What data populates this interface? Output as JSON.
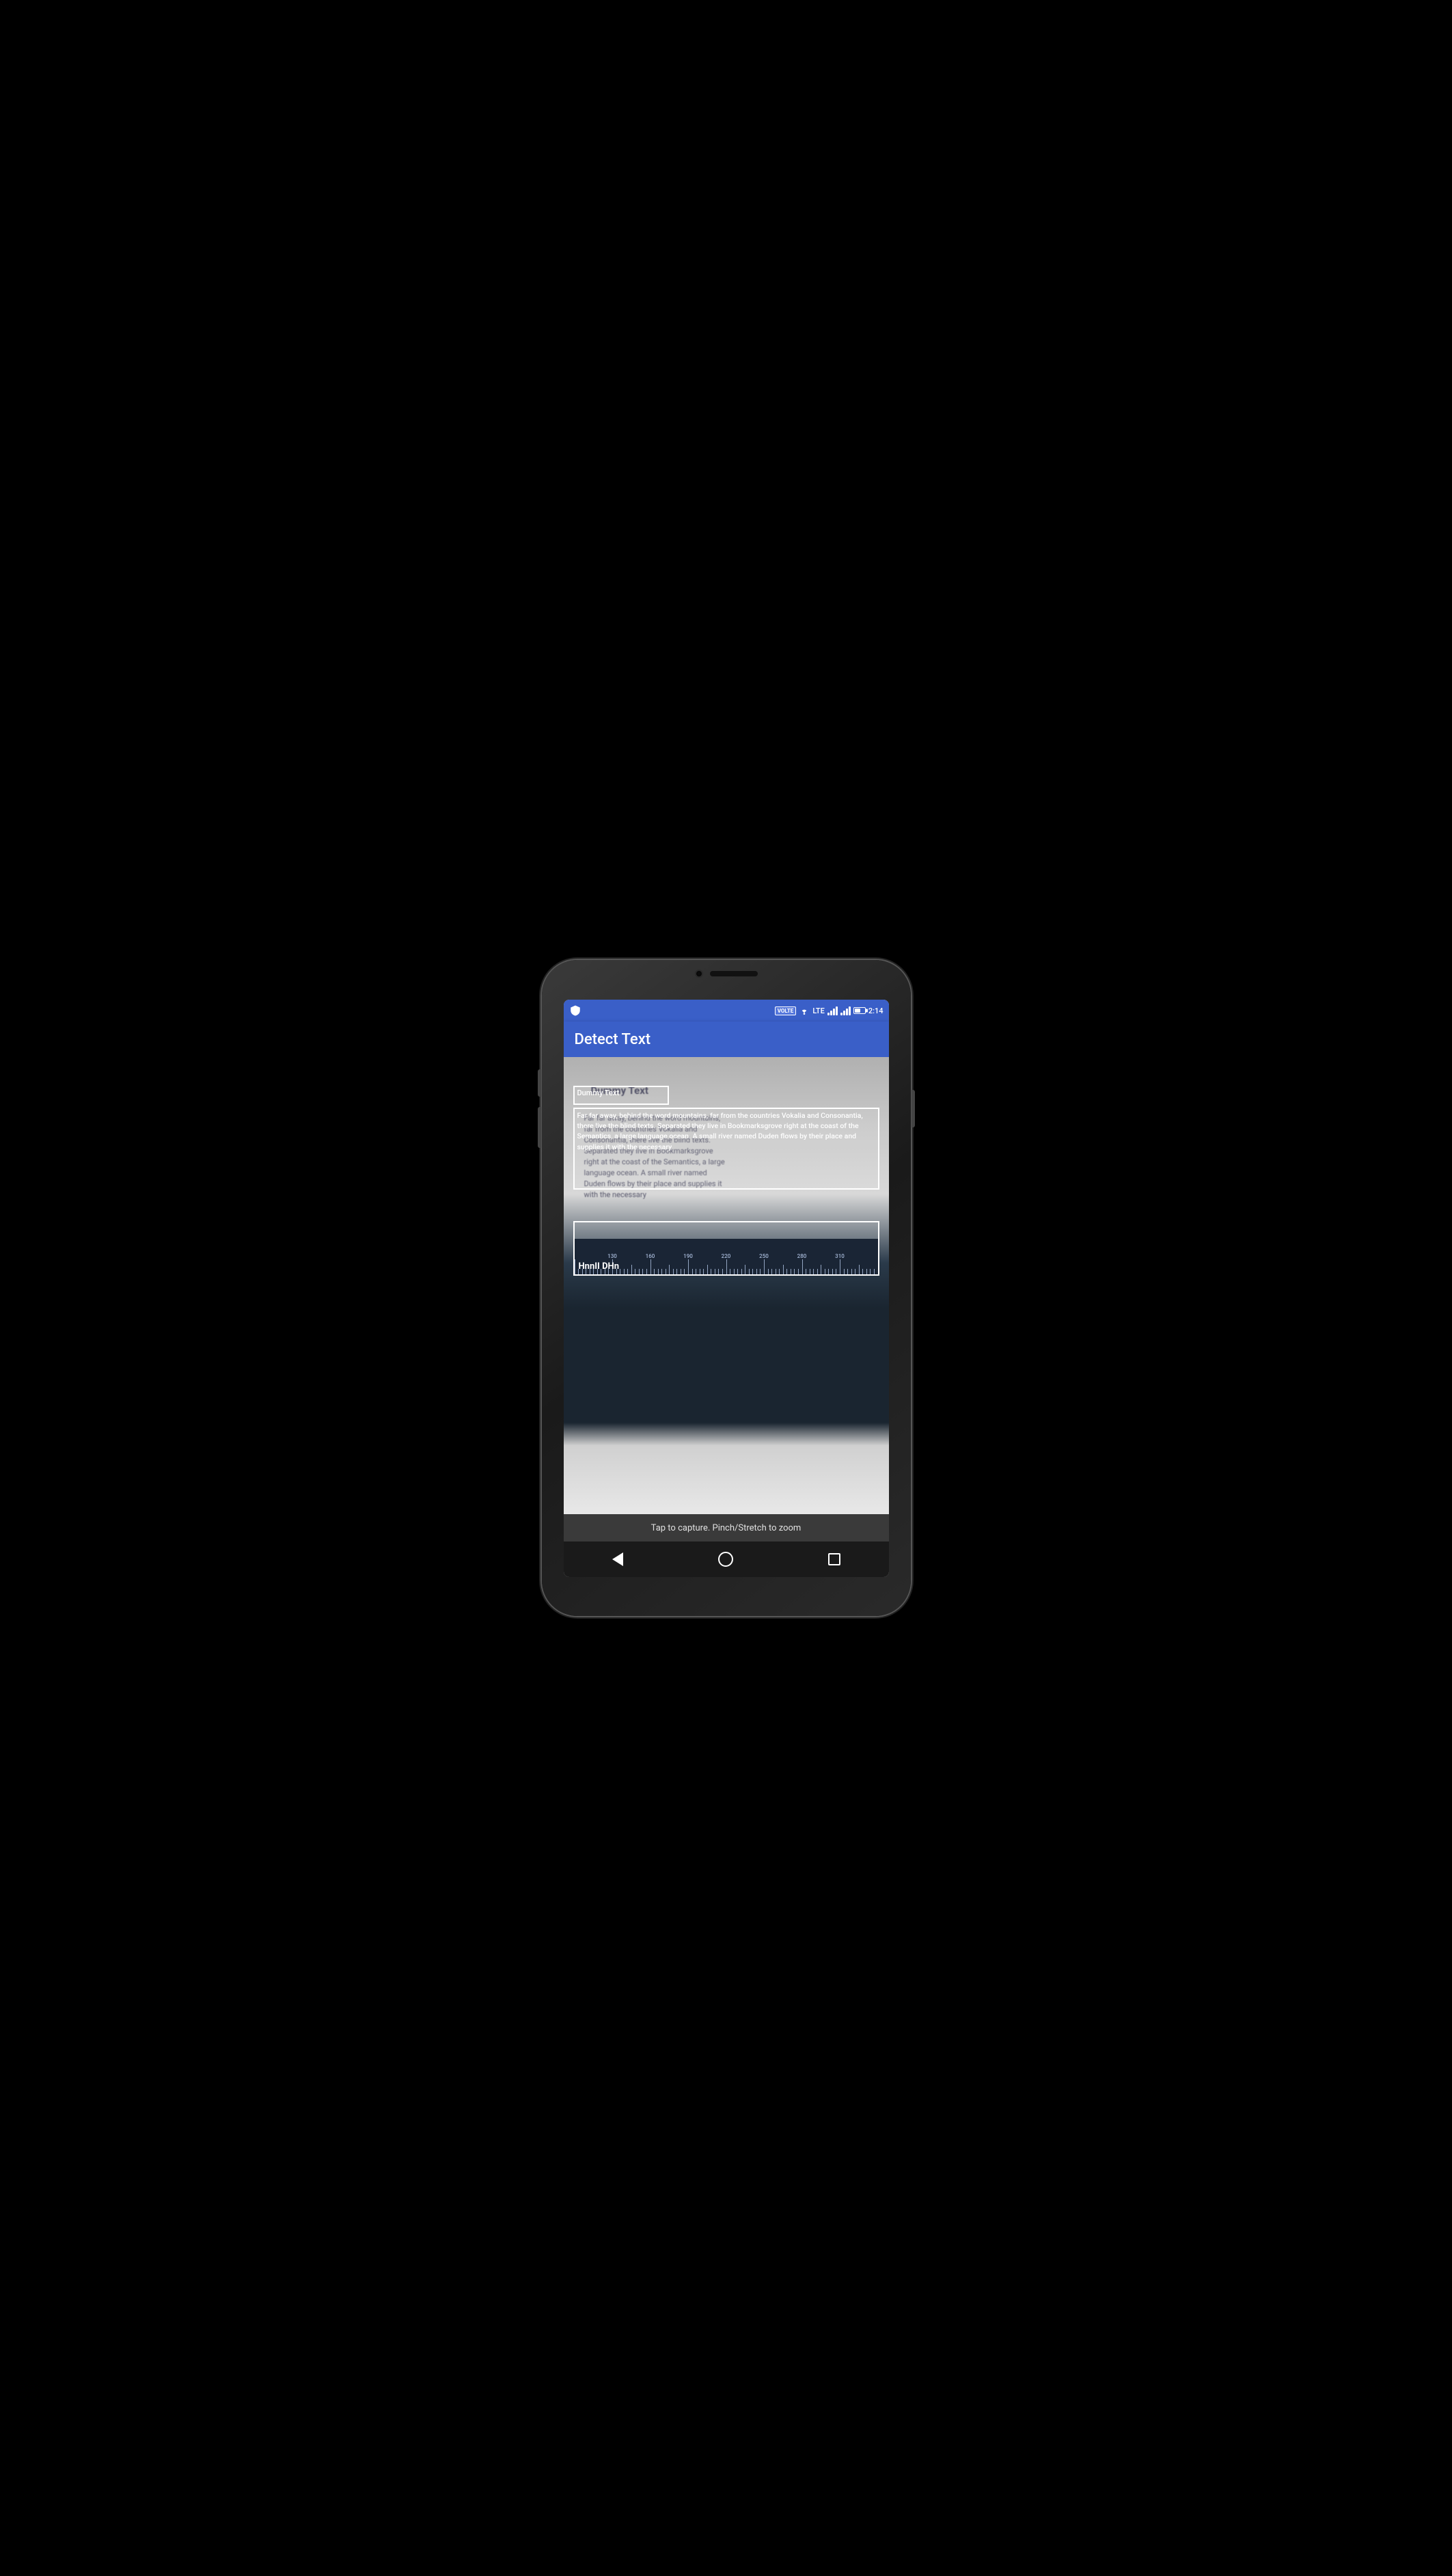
{
  "device": {
    "label": "Android Phone"
  },
  "status_bar": {
    "app_icon": "N",
    "volte": "VOLTE",
    "wifi": "wifi",
    "lte": "LTE",
    "signal1": "signal",
    "signal2": "signal",
    "battery": "battery",
    "time": "2:14"
  },
  "app_bar": {
    "title": "Detect Text"
  },
  "camera": {
    "hint": "Tap to capture. Pinch/Stretch to zoom"
  },
  "detected_boxes": {
    "box1_text": "Dummy Text",
    "box2_text": "Far far away, behind the word mountains, far from the countries Vokalia and Consonantia, there live the blind texts. Separated they live in Bookmarksgrove right at the coast of the Semantics, a large language ocean. A small river named Duden flows by their place and supplies it with the necessary",
    "box3_text": "HnnII DHn"
  },
  "blurred_background_text": {
    "line1": "Dummy Text",
    "line2": "Far far away, behind the word mountains,",
    "line3": "far from the countries Vokalia and",
    "line4": "Consonantia, there live the blind texts.",
    "line5": "Separated they live in Bookmarksgrove",
    "line6": "right at the coast of the Semantics, a large",
    "line7": "language ocean. A small river named",
    "line8": "Duden flows by their place and supplies it",
    "line9": "with the necessary"
  },
  "navigation": {
    "back_label": "back",
    "home_label": "home",
    "recent_label": "recent"
  }
}
